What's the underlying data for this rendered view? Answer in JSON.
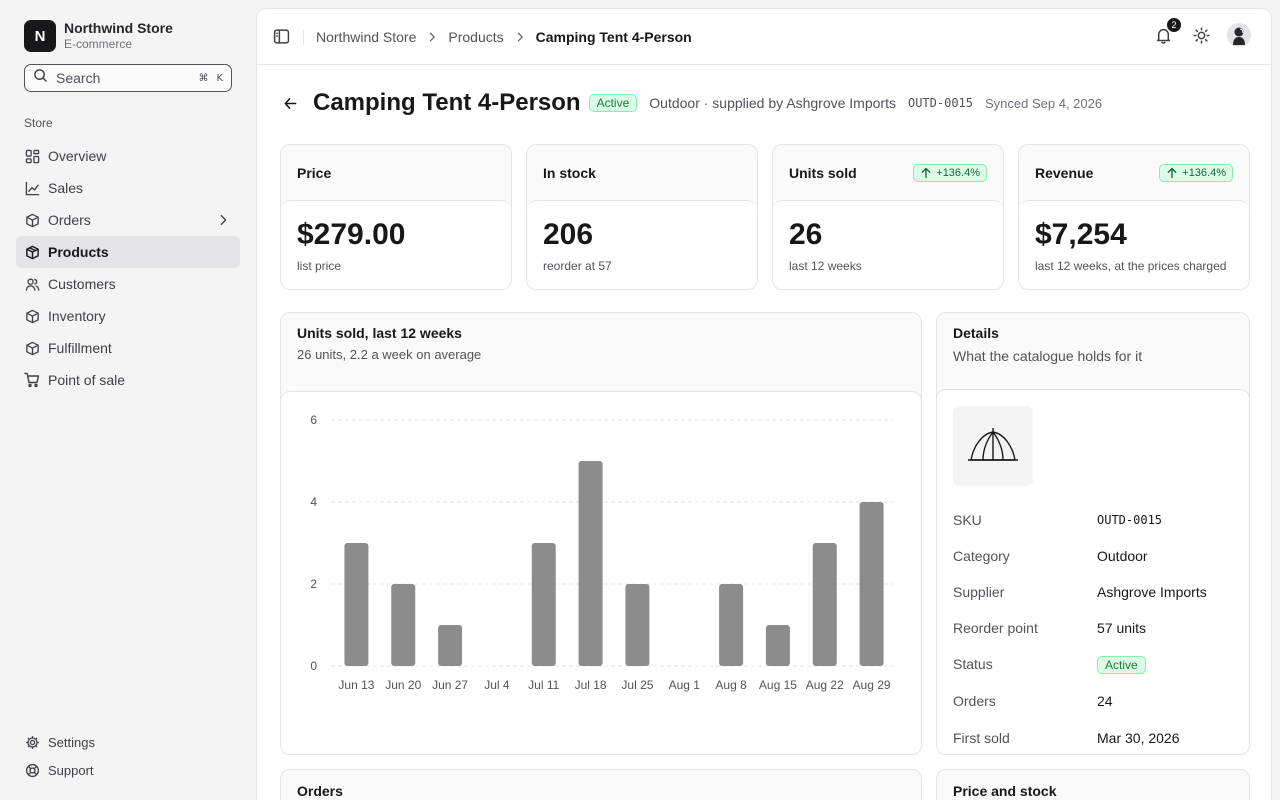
{
  "brand": {
    "initial": "N",
    "name": "Northwind Store",
    "subtitle": "E-commerce"
  },
  "search": {
    "placeholder": "Search",
    "shortcut_mod": "⌘",
    "shortcut_key": "K"
  },
  "sidebar": {
    "group_label": "Store",
    "items": [
      {
        "label": "Overview",
        "icon": "layout-grid-icon"
      },
      {
        "label": "Sales",
        "icon": "line-chart-icon"
      },
      {
        "label": "Orders",
        "icon": "package-icon"
      },
      {
        "label": "Products",
        "icon": "box-icon"
      },
      {
        "label": "Customers",
        "icon": "users-icon"
      },
      {
        "label": "Inventory",
        "icon": "box-icon"
      },
      {
        "label": "Fulfillment",
        "icon": "box-icon"
      },
      {
        "label": "Point of sale",
        "icon": "cart-icon"
      }
    ],
    "active": "Products",
    "footer": [
      {
        "label": "Settings",
        "icon": "gear-icon"
      },
      {
        "label": "Support",
        "icon": "lifebuoy-icon"
      }
    ]
  },
  "topbar": {
    "breadcrumbs": [
      "Northwind Store",
      "Products",
      "Camping Tent 4-Person"
    ],
    "notification_count": "2"
  },
  "product": {
    "title": "Camping Tent 4-Person",
    "status": "Active",
    "meta": "Outdoor · supplied by Ashgrove Imports",
    "sku": "OUTD-0015",
    "synced": "Synced Sep 4, 2026"
  },
  "stats": [
    {
      "label": "Price",
      "value": "$279.00",
      "note": "list price",
      "delta": ""
    },
    {
      "label": "In stock",
      "value": "206",
      "note": "reorder at 57",
      "delta": ""
    },
    {
      "label": "Units sold",
      "value": "26",
      "note": "last 12 weeks",
      "delta": "+136.4%"
    },
    {
      "label": "Revenue",
      "value": "$7,254",
      "note": "last 12 weeks, at the prices charged",
      "delta": "+136.4%"
    }
  ],
  "chart_card": {
    "title": "Units sold, last 12 weeks",
    "subtitle": "26 units, 2.2 a week on average"
  },
  "chart_data": {
    "type": "bar",
    "categories": [
      "Jun 13",
      "Jun 20",
      "Jun 27",
      "Jul 4",
      "Jul 11",
      "Jul 18",
      "Jul 25",
      "Aug 1",
      "Aug 8",
      "Aug 15",
      "Aug 22",
      "Aug 29"
    ],
    "values": [
      3,
      2,
      1,
      0,
      3,
      5,
      2,
      0,
      2,
      1,
      3,
      4
    ],
    "yticks": [
      0,
      2,
      4,
      6
    ],
    "ylim": [
      0,
      6
    ],
    "grid": true,
    "bar_color": "#8c8c8c"
  },
  "details": {
    "title": "Details",
    "subtitle": "What the catalogue holds for it",
    "rows": [
      {
        "label": "SKU",
        "value": "OUTD-0015"
      },
      {
        "label": "Category",
        "value": "Outdoor"
      },
      {
        "label": "Supplier",
        "value": "Ashgrove Imports"
      },
      {
        "label": "Reorder point",
        "value": "57 units"
      },
      {
        "label": "Status",
        "value": "Active"
      },
      {
        "label": "Orders",
        "value": "24"
      },
      {
        "label": "First sold",
        "value": "Mar 30, 2026"
      }
    ]
  },
  "bottom_cards": {
    "orders": "Orders",
    "price_stock": "Price and stock"
  },
  "colors": {
    "accent_green_bg": "#dcfce7",
    "accent_green_text": "#15803d",
    "sidebar_active": "#e4e4e7"
  }
}
